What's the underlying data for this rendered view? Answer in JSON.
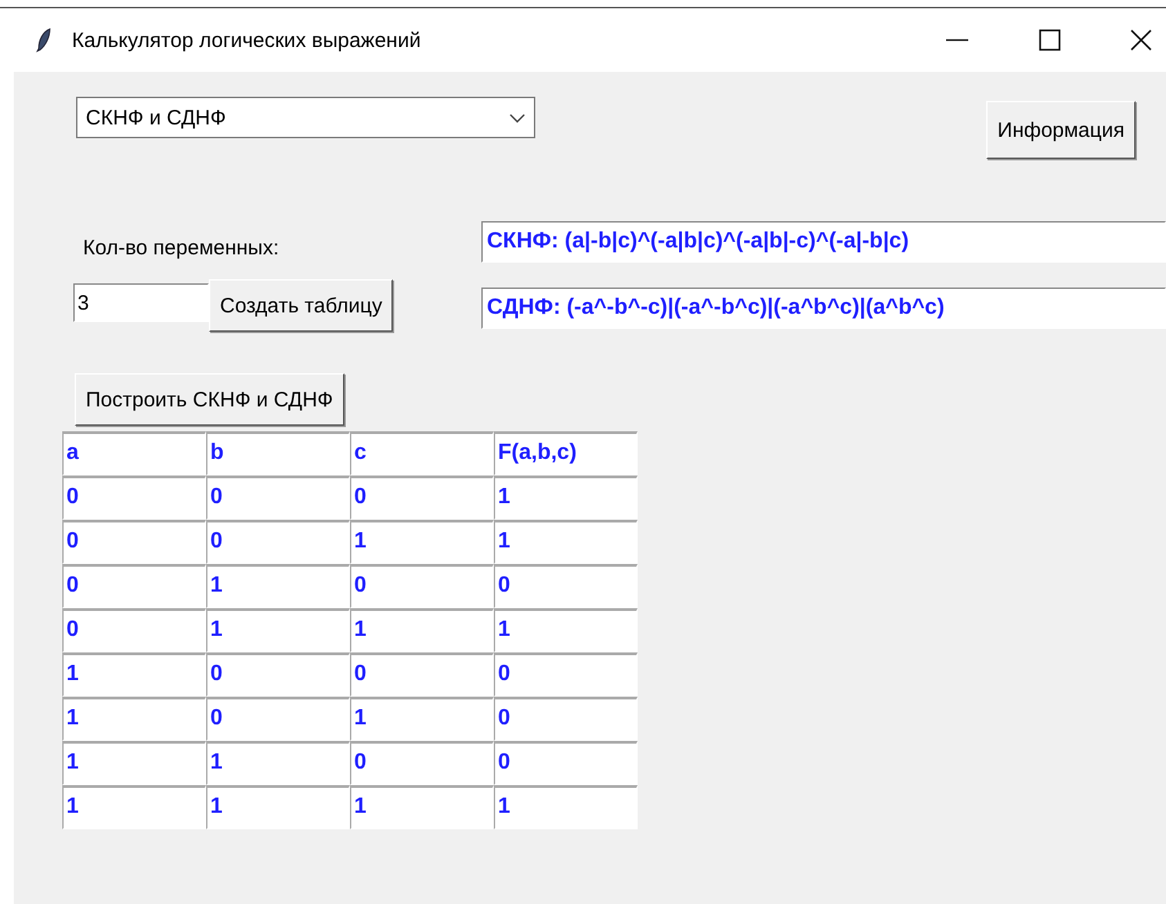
{
  "window": {
    "title": "Калькулятор логических выражений"
  },
  "mode_select": {
    "value": "СКНФ и СДНФ"
  },
  "info_button": {
    "label": "Информация"
  },
  "variables": {
    "label": "Кол-во переменных:",
    "value": "3"
  },
  "create_button": {
    "label": "Создать таблицу"
  },
  "results": [
    "СКНФ: (a|-b|c)^(-a|b|c)^(-a|b|-c)^(-a|-b|c)",
    "СДНФ: (-a^-b^-c)|(-a^-b^c)|(-a^b^c)|(a^b^c)"
  ],
  "build_button": {
    "label": "Построить СКНФ и СДНФ"
  },
  "table": {
    "columns": [
      "a",
      "b",
      "c",
      "F(a,b,c)"
    ],
    "rows": [
      [
        "0",
        "0",
        "0",
        "1"
      ],
      [
        "0",
        "0",
        "1",
        "1"
      ],
      [
        "0",
        "1",
        "0",
        "0"
      ],
      [
        "0",
        "1",
        "1",
        "1"
      ],
      [
        "1",
        "0",
        "0",
        "0"
      ],
      [
        "1",
        "0",
        "1",
        "0"
      ],
      [
        "1",
        "1",
        "0",
        "0"
      ],
      [
        "1",
        "1",
        "1",
        "1"
      ]
    ]
  }
}
